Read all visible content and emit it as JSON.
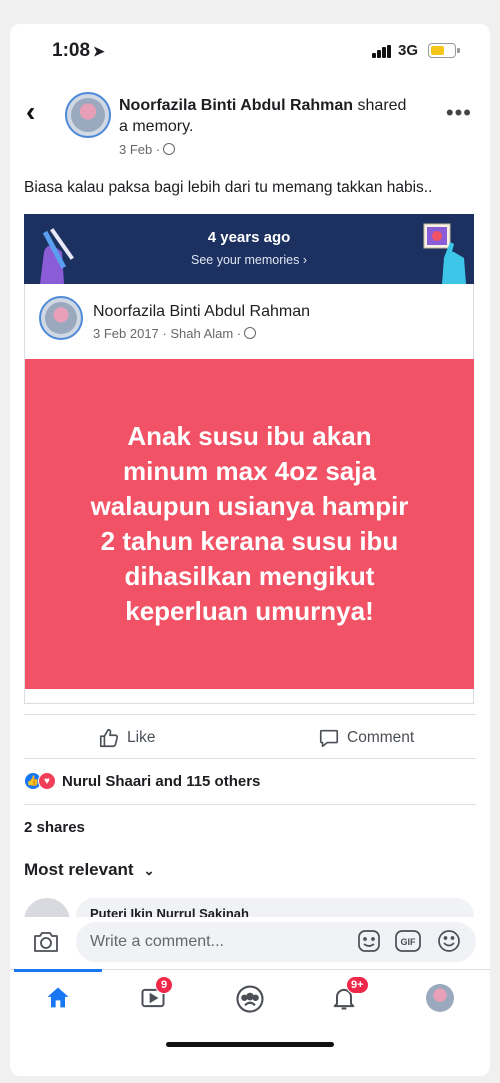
{
  "status_bar": {
    "time": "1:08",
    "network": "3G"
  },
  "post": {
    "author": "Noorfazila Binti Abdul Rahman",
    "action_text": " shared",
    "action_text_2": "a memory.",
    "date": "3 Feb ·",
    "caption": "Biasa kalau paksa bagi lebih dari tu memang takkan habis.."
  },
  "memory_banner": {
    "title": "4 years ago",
    "link": "See your memories ›"
  },
  "shared_post": {
    "author": "Noorfazila Binti Abdul Rahman",
    "meta": "3 Feb 2017 · Shah Alam ·",
    "text": "Anak susu ibu akan\nminum max 4oz saja\nwalaupun usianya hampir\n2 tahun kerana susu ibu\ndihasilkan mengikut\nkeperluan umurnya!",
    "background_color": "#f25265"
  },
  "actions": {
    "like": "Like",
    "comment": "Comment"
  },
  "reactions": {
    "summary": "Nurul Shaari and 115 others"
  },
  "shares": "2 shares",
  "comments": {
    "sort_label": "Most relevant",
    "first_commenter": "Puteri Ikin Nurrul Sakinah"
  },
  "composer": {
    "placeholder": "Write a comment..."
  },
  "tabbar": {
    "video_badge": "9",
    "notifications_badge": "9+"
  },
  "colors": {
    "accent": "#1877f2",
    "banner": "#1c3160",
    "badge": "#f02849"
  }
}
